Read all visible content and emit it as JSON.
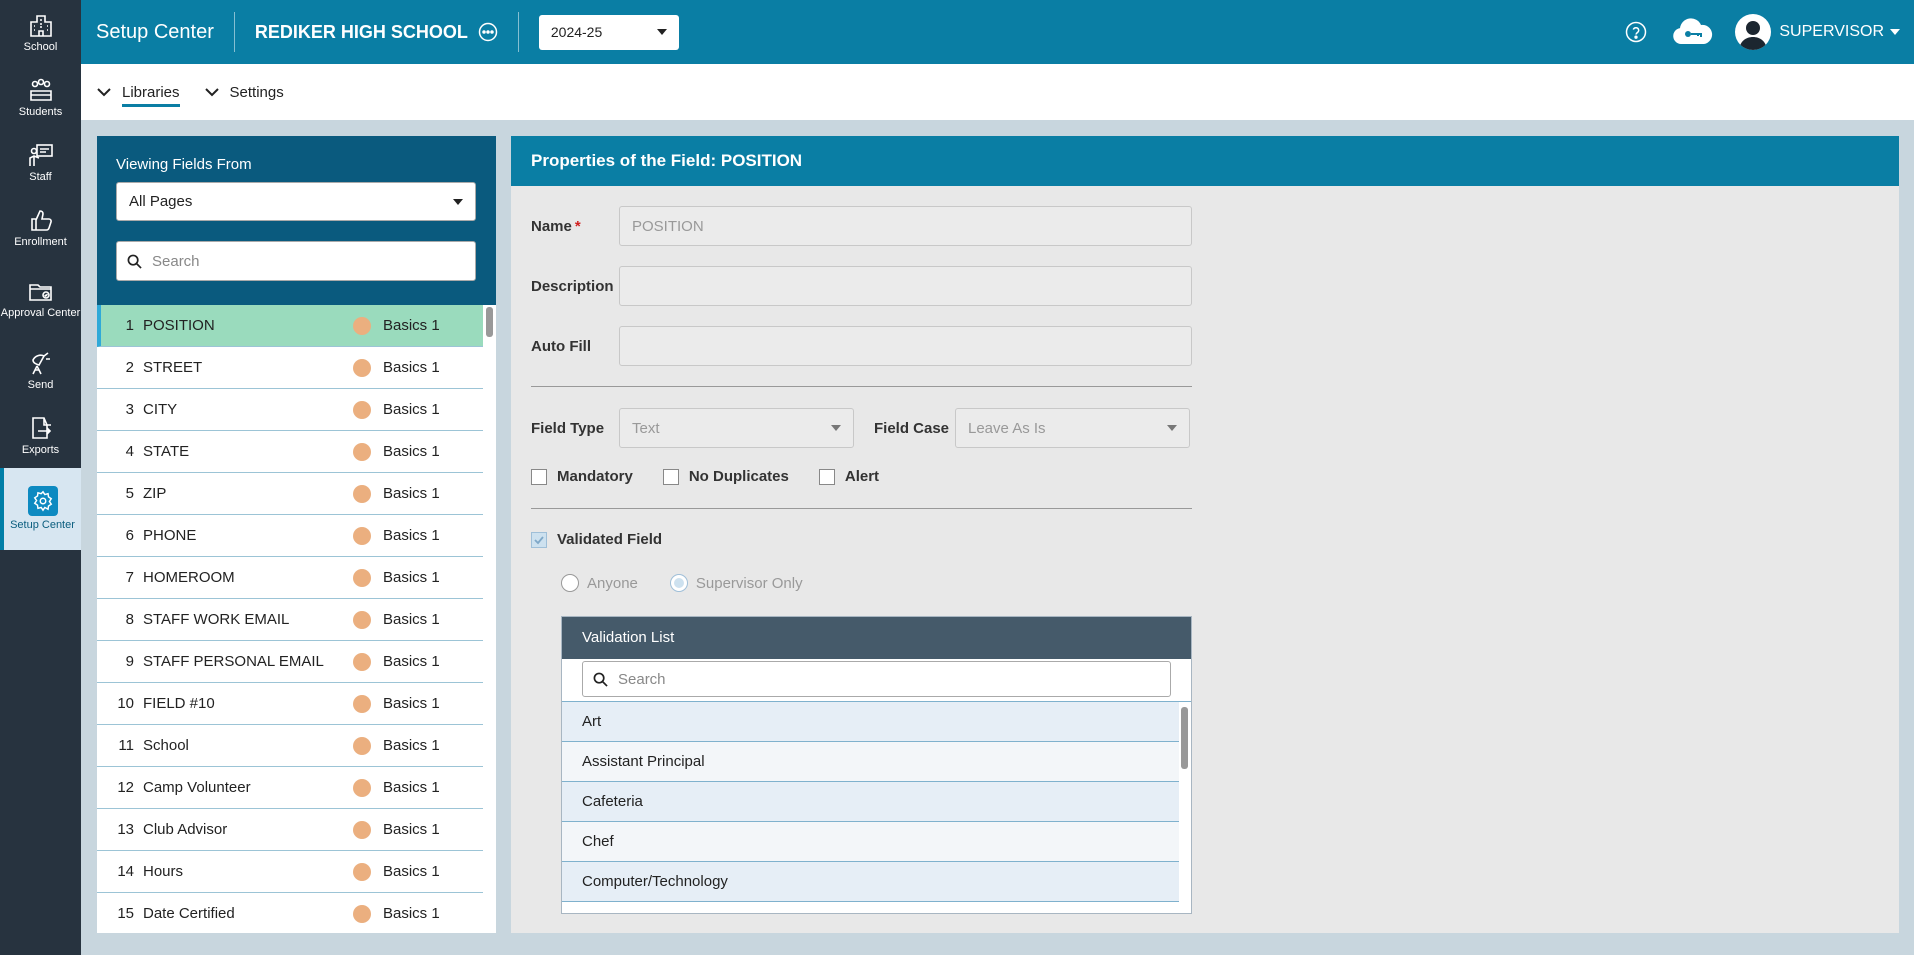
{
  "rail": [
    {
      "label": "School",
      "icon": "school-icon"
    },
    {
      "label": "Students",
      "icon": "students-icon"
    },
    {
      "label": "Staff",
      "icon": "staff-icon"
    },
    {
      "label": "Enrollment",
      "icon": "enrollment-icon"
    },
    {
      "label": "Approval Center",
      "icon": "approval-center-icon"
    },
    {
      "label": "Send",
      "icon": "send-icon"
    },
    {
      "label": "Exports",
      "icon": "exports-icon"
    },
    {
      "label": "Setup Center",
      "icon": "setup-center-icon",
      "active": true
    }
  ],
  "header": {
    "app_title": "Setup Center",
    "school_name": "REDIKER HIGH SCHOOL",
    "year": "2024-25",
    "user": "SUPERVISOR"
  },
  "subnav": {
    "libraries": "Libraries",
    "settings": "Settings"
  },
  "left": {
    "viewing_label": "Viewing Fields From",
    "page_select": "All Pages",
    "search_placeholder": "Search",
    "fields": [
      {
        "num": "1",
        "name": "POSITION",
        "group": "Basics 1"
      },
      {
        "num": "2",
        "name": "STREET",
        "group": "Basics 1"
      },
      {
        "num": "3",
        "name": "CITY",
        "group": "Basics 1"
      },
      {
        "num": "4",
        "name": "STATE",
        "group": "Basics 1"
      },
      {
        "num": "5",
        "name": "ZIP",
        "group": "Basics 1"
      },
      {
        "num": "6",
        "name": "PHONE",
        "group": "Basics 1"
      },
      {
        "num": "7",
        "name": "HOMEROOM",
        "group": "Basics 1"
      },
      {
        "num": "8",
        "name": "STAFF WORK EMAIL",
        "group": "Basics 1"
      },
      {
        "num": "9",
        "name": "STAFF PERSONAL EMAIL",
        "group": "Basics 1"
      },
      {
        "num": "10",
        "name": "FIELD #10",
        "group": "Basics 1"
      },
      {
        "num": "11",
        "name": "School",
        "group": "Basics 1"
      },
      {
        "num": "12",
        "name": "Camp Volunteer",
        "group": "Basics 1"
      },
      {
        "num": "13",
        "name": "Club Advisor",
        "group": "Basics 1"
      },
      {
        "num": "14",
        "name": "Hours",
        "group": "Basics 1"
      },
      {
        "num": "15",
        "name": "Date Certified",
        "group": "Basics 1"
      }
    ],
    "dot_color": "#ebaf7f"
  },
  "props": {
    "title": "Properties of the Field: POSITION",
    "name_label": "Name",
    "required_mark": "*",
    "name_value": "POSITION",
    "description_label": "Description",
    "description_value": "",
    "autofill_label": "Auto Fill",
    "autofill_value": "",
    "field_type_label": "Field Type",
    "field_type_value": "Text",
    "field_case_label": "Field Case",
    "field_case_value": "Leave As Is",
    "mandatory_label": "Mandatory",
    "no_duplicates_label": "No Duplicates",
    "alert_label": "Alert",
    "validated_label": "Validated Field",
    "anyone_label": "Anyone",
    "supervisor_only_label": "Supervisor Only"
  },
  "validation": {
    "title": "Validation List",
    "search_placeholder": "Search",
    "items": [
      "Art",
      "Assistant Principal",
      "Cafeteria",
      "Chef",
      "Computer/Technology"
    ]
  }
}
